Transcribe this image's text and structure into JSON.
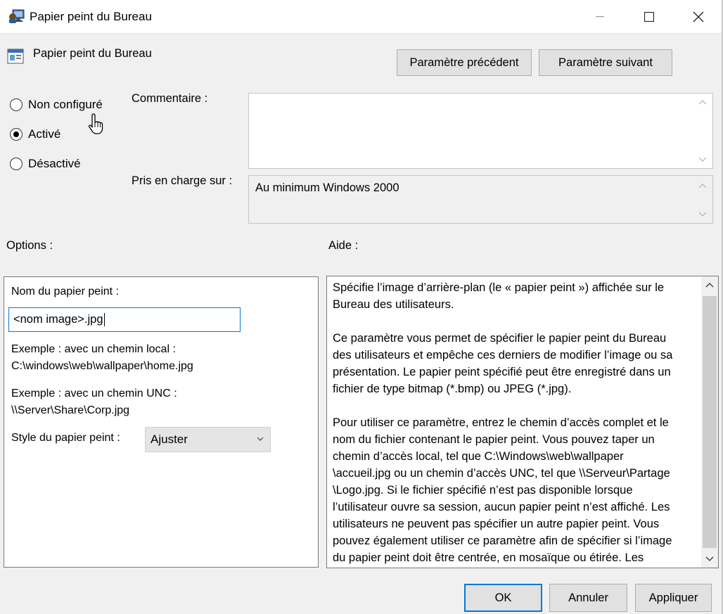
{
  "window": {
    "title": "Papier peint du Bureau",
    "icon": "group-policy-icon"
  },
  "header": {
    "title": "Papier peint du Bureau",
    "icon": "policy-setting-icon",
    "prev_label": "Paramètre précédent",
    "next_label": "Paramètre suivant"
  },
  "state": {
    "options": [
      {
        "label": "Non configuré",
        "checked": false
      },
      {
        "label": "Activé",
        "checked": true
      },
      {
        "label": "Désactivé",
        "checked": false
      }
    ]
  },
  "comment": {
    "label": "Commentaire :",
    "value": ""
  },
  "supported": {
    "label": "Pris en charge sur :",
    "value": "Au minimum Windows 2000"
  },
  "options": {
    "label": "Options :",
    "wallpaper_name_label": "Nom du papier peint :",
    "wallpaper_name_value": "<nom image>.jpg",
    "example_local_label": "Exemple : avec un chemin local :",
    "example_local_path": "C:\\windows\\web\\wallpaper\\home.jpg",
    "example_unc_label": "Exemple : avec un chemin UNC :",
    "example_unc_path": "\\\\Server\\Share\\Corp.jpg",
    "style_label": "Style du papier peint :",
    "style_value": "Ajuster"
  },
  "help": {
    "label": "Aide :",
    "lines_p1": [
      "Spécifie l’image d’arrière-plan (le « papier peint ») affichée sur le",
      "Bureau des utilisateurs."
    ],
    "lines_p2": [
      "Ce paramètre vous permet de spécifier le papier peint du Bureau",
      "des utilisateurs et empêche ces derniers de modifier l’image ou sa",
      "présentation. Le papier peint spécifié peut être enregistré dans un",
      "fichier de type bitmap (*.bmp) ou JPEG (*.jpg)."
    ],
    "lines_p3": [
      "Pour utiliser ce paramètre, entrez le chemin d’accès complet et le",
      "nom du fichier contenant le papier peint. Vous pouvez taper un",
      "chemin d’accès local, tel que C:\\Windows\\web\\wallpaper",
      "\\accueil.jpg ou un chemin d’accès UNC, tel que \\\\Serveur\\Partage",
      "\\Logo.jpg. Si le fichier spécifié n’est pas disponible lorsque",
      "l’utilisateur ouvre sa session, aucun papier peint n’est affiché. Les",
      "utilisateurs ne peuvent pas spécifier un autre papier peint. Vous",
      "pouvez également utiliser ce paramètre afin de spécifier si l’image",
      "du papier peint doit être centrée, en mosaïque ou étirée. Les"
    ]
  },
  "footer": {
    "ok_label": "OK",
    "cancel_label": "Annuler",
    "apply_label": "Appliquer"
  },
  "colors": {
    "accent": "#0078d7",
    "button_bg": "#e1e1e1",
    "dialog_bg": "#f0f0f0"
  }
}
